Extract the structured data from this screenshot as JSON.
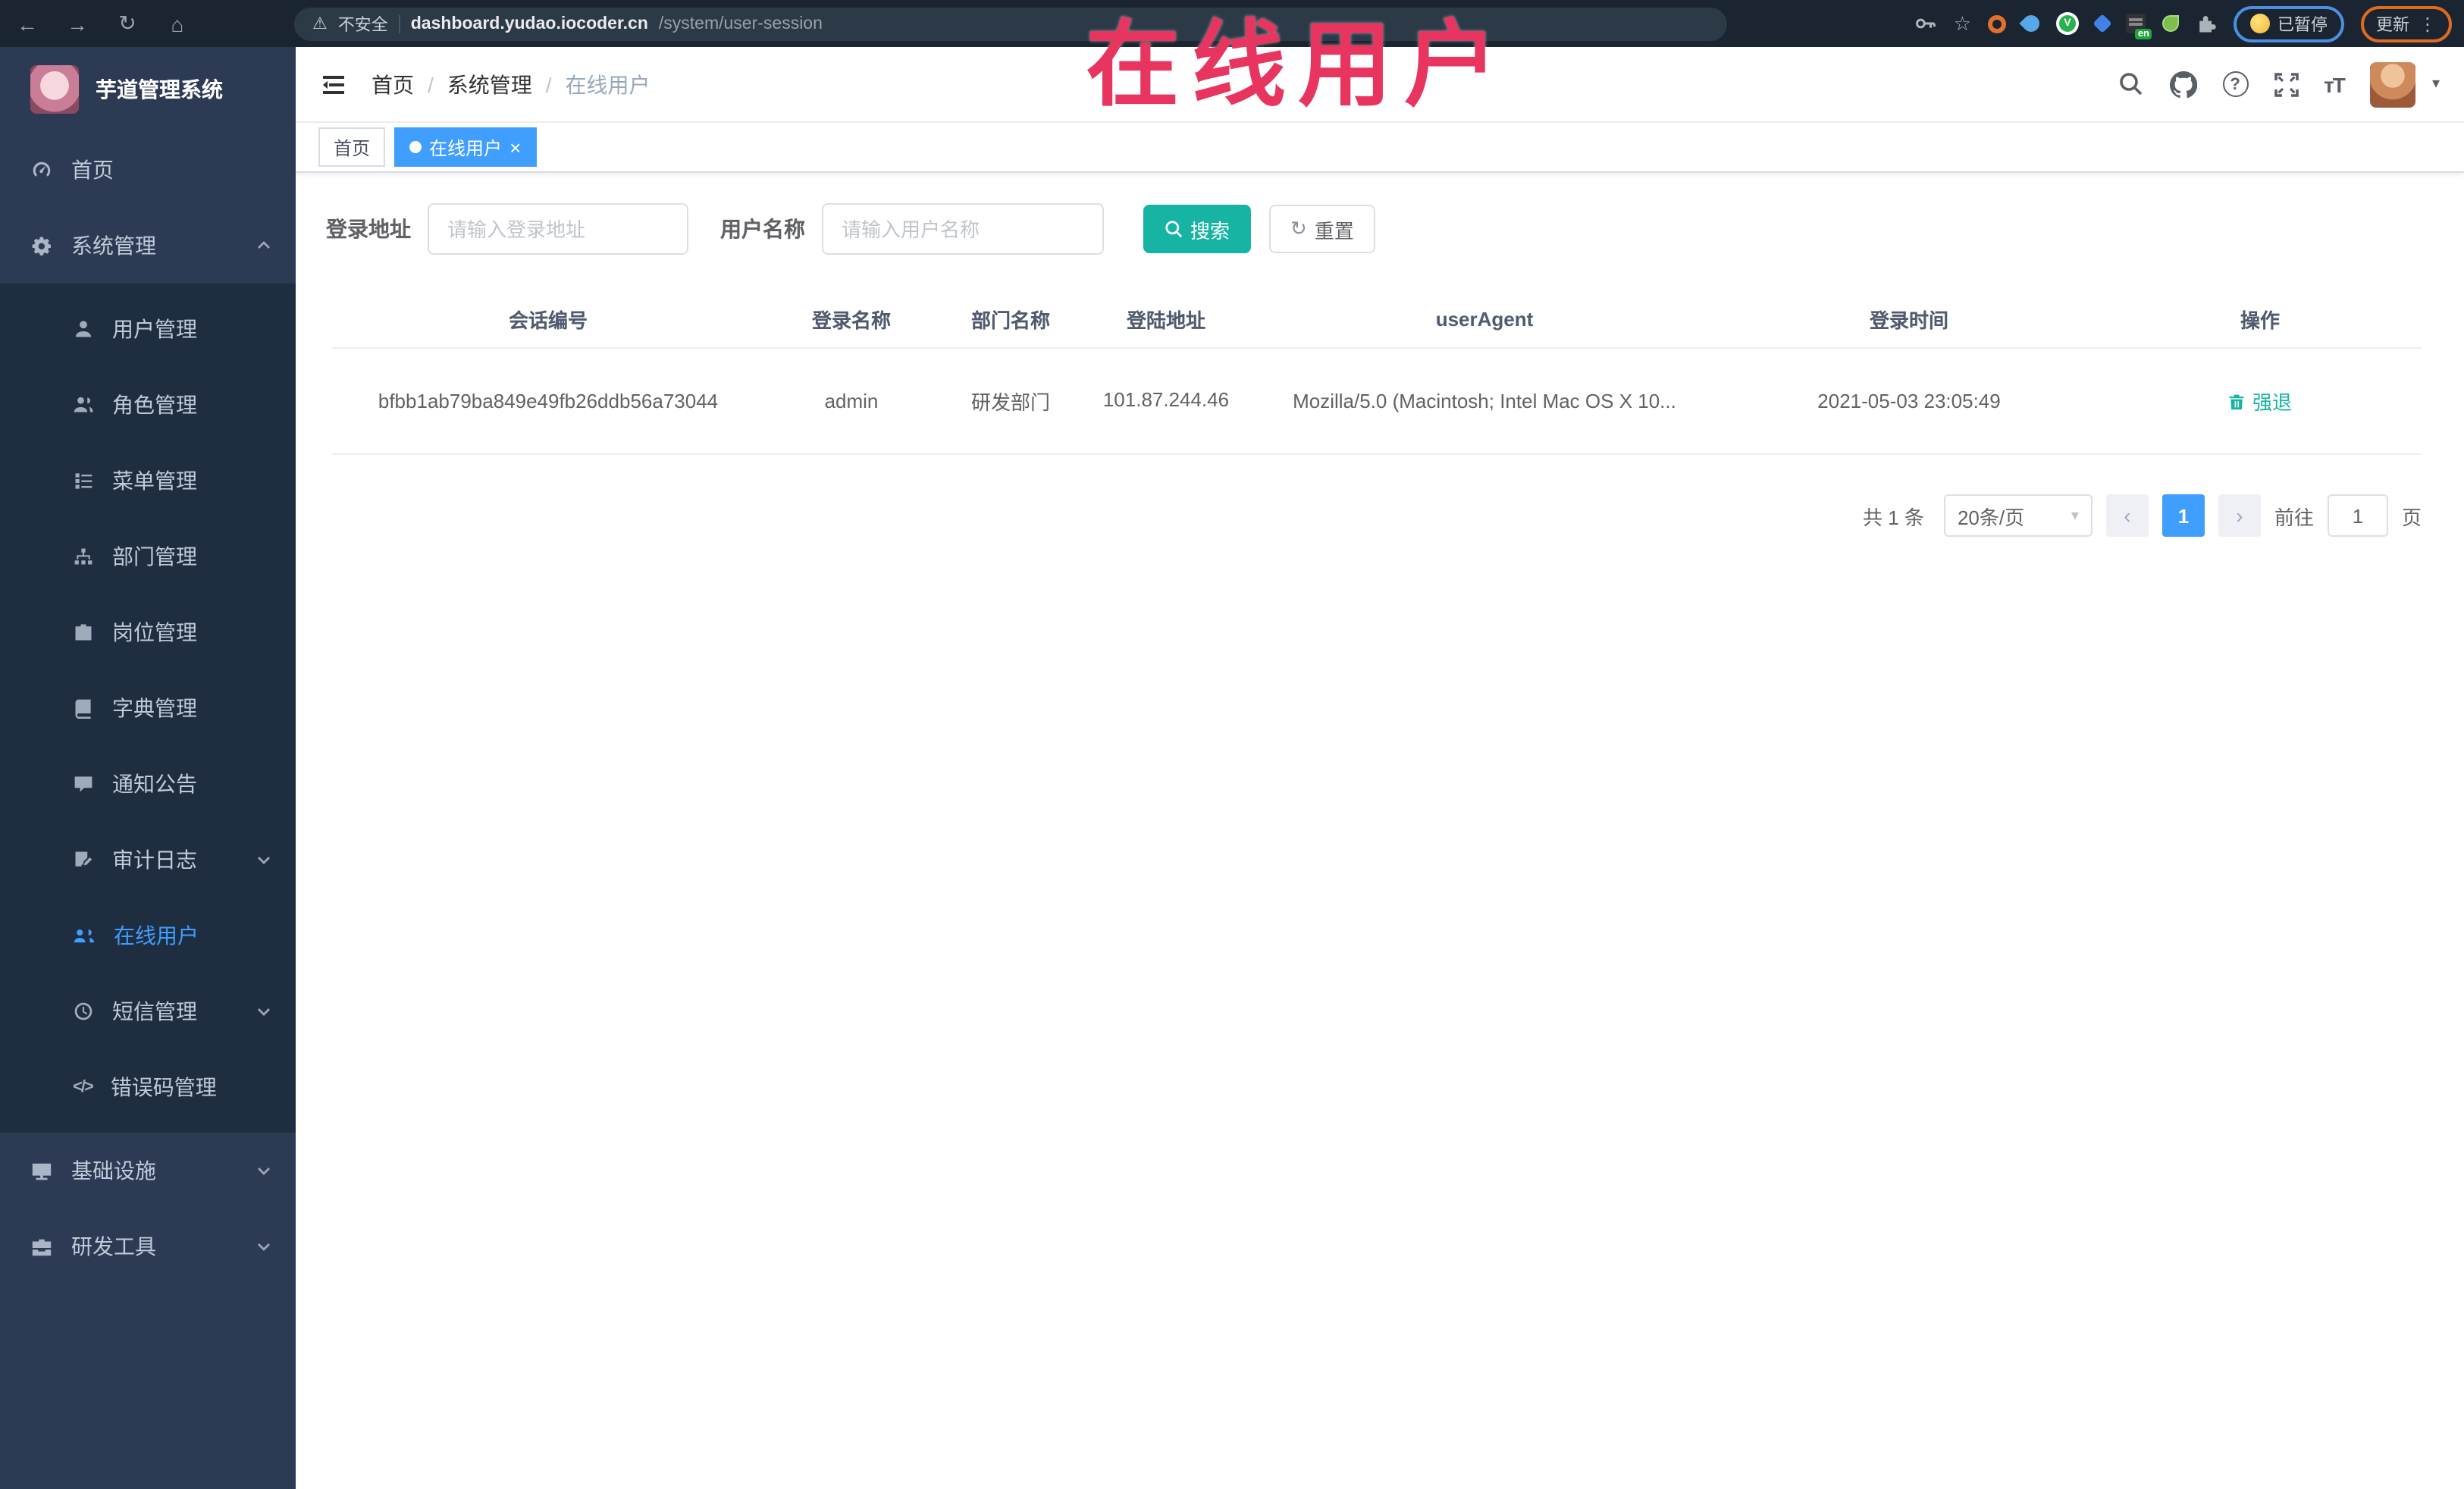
{
  "browser": {
    "security": "不安全",
    "domain": "dashboard.yudao.iocoder.cn",
    "path": "/system/user-session",
    "paused_chip": "已暂停",
    "update_label": "更新",
    "ext_badge": "en"
  },
  "annotation": {
    "text": "在线用户",
    "color": "#e8355f"
  },
  "icons": {
    "back": "←",
    "forward": "→",
    "reload": "↻",
    "home": "⌂",
    "warning": "⚠",
    "star": "☆",
    "more": "⋮",
    "caret": "▾",
    "prev": "‹",
    "next": "›",
    "close": "×",
    "reset": "↻",
    "font_size": "тT",
    "code": "</>",
    "question": "?",
    "v_badge": "V"
  },
  "sidebar": {
    "title": "芋道管理系统",
    "home": "首页",
    "system": "系统管理",
    "submenu": [
      "用户管理",
      "角色管理",
      "菜单管理",
      "部门管理",
      "岗位管理",
      "字典管理",
      "通知公告",
      "审计日志",
      "在线用户",
      "短信管理",
      "错误码管理"
    ],
    "sections": [
      "基础设施",
      "研发工具"
    ]
  },
  "breadcrumb": {
    "items": [
      "首页",
      "系统管理",
      "在线用户"
    ],
    "separator": "/"
  },
  "tags": {
    "home": "首页",
    "active": "在线用户"
  },
  "filters": {
    "addr_label": "登录地址",
    "addr_placeholder": "请输入登录地址",
    "name_label": "用户名称",
    "name_placeholder": "请输入用户名称",
    "search": "搜索",
    "reset": "重置"
  },
  "table": {
    "columns": [
      "会话编号",
      "登录名称",
      "部门名称",
      "登陆地址",
      "userAgent",
      "登录时间",
      "操作"
    ],
    "row": {
      "session_id": "bfbb1ab79ba849e49fb26ddb56a73044",
      "username": "admin",
      "dept": "研发部门",
      "ip": "101.87.244.46",
      "user_agent": "Mozilla/5.0 (Macintosh; Intel Mac OS X 10...",
      "login_time": "2021-05-03 23:05:49",
      "action": "强退"
    }
  },
  "pagination": {
    "total": "共 1 条",
    "page_size": "20条/页",
    "current_page": "1",
    "goto_label": "前往",
    "goto_value": "1",
    "unit": "页"
  },
  "colors": {
    "primary": "#409eff",
    "accent_teal": "#17b3a3",
    "sidebar_bg": "#2d3a54",
    "submenu_bg": "#1f2d40",
    "chrome_bg": "#1b2531"
  }
}
